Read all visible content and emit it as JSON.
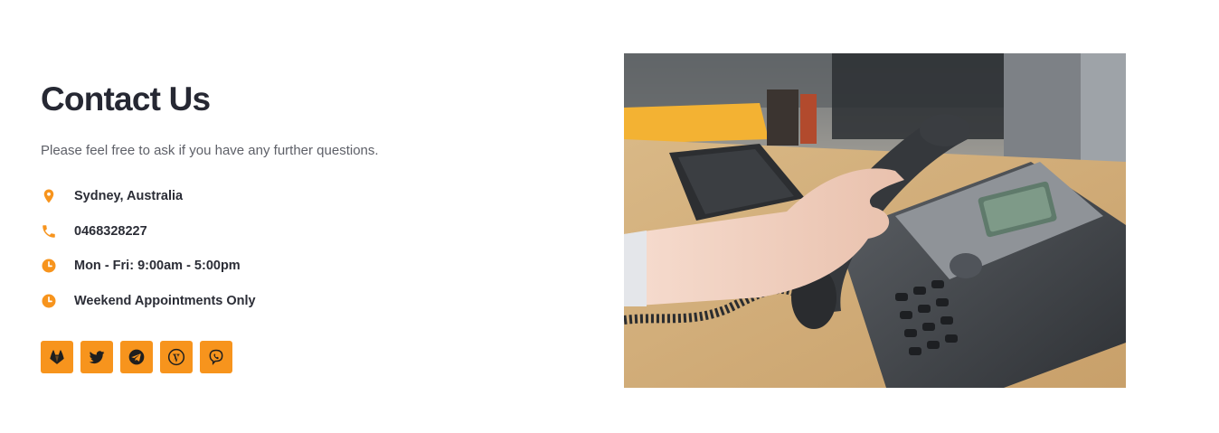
{
  "contact": {
    "title": "Contact Us",
    "subtitle": "Please feel free to ask if you have any further questions.",
    "items": [
      {
        "icon": "map-pin-icon",
        "text": "Sydney, Australia"
      },
      {
        "icon": "phone-icon",
        "text": "0468328227"
      },
      {
        "icon": "clock-icon",
        "text": "Mon - Fri: 9:00am - 5:00pm"
      },
      {
        "icon": "clock-icon",
        "text": "Weekend Appointments Only"
      }
    ]
  },
  "socials": [
    {
      "icon": "gitlab-icon"
    },
    {
      "icon": "twitter-icon"
    },
    {
      "icon": "telegram-icon"
    },
    {
      "icon": "wordpress-icon"
    },
    {
      "icon": "viber-icon"
    }
  ],
  "colors": {
    "accent": "#f7941d",
    "heading": "#262833",
    "body_text": "#5e6068"
  },
  "photo": {
    "subject": "hand-holding-office-desk-phone-image"
  }
}
